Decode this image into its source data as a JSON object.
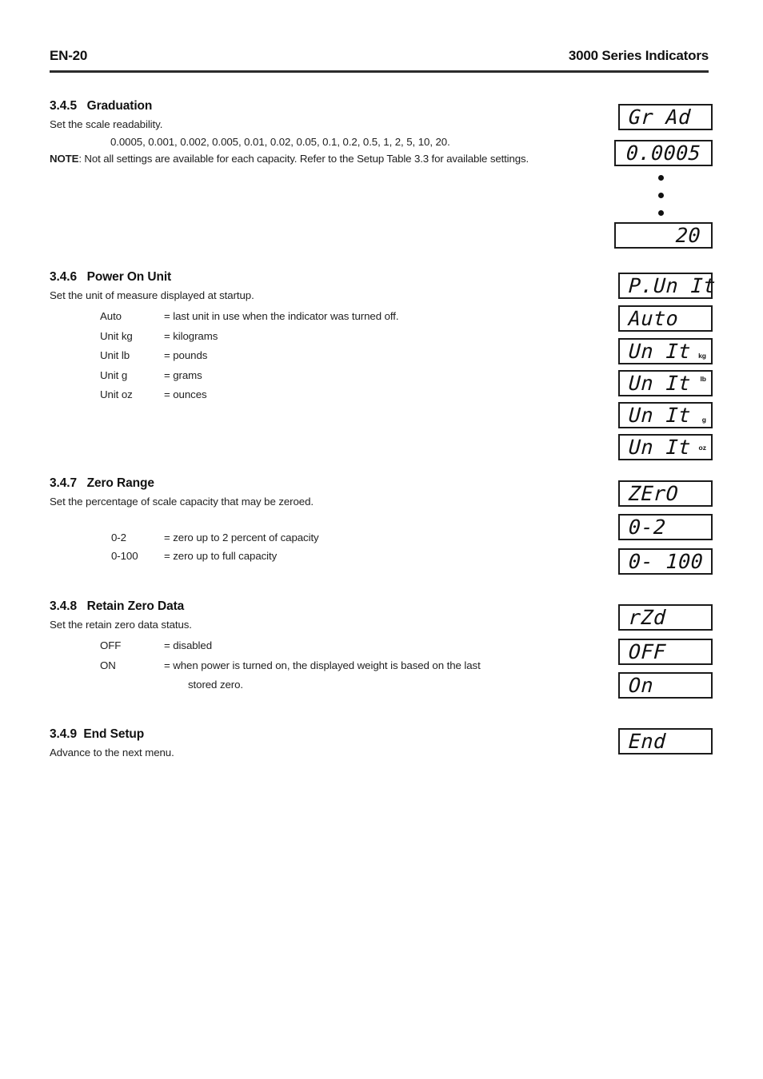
{
  "header": {
    "page_label": "EN-20",
    "doc_title": "3000 Series Indicators"
  },
  "sections": {
    "graduation": {
      "number": "3.4.5",
      "title": "Graduation",
      "description": "Set the scale readability.",
      "values": "0.0005, 0.001, 0.002, 0.005, 0.01, 0.02, 0.05, 0.1, 0.2, 0.5, 1, 2, 5, 10, 20.",
      "note_label": "NOTE",
      "note_text": ": Not all settings are available for each capacity.  Refer to the Setup Table 3.3 for available settings."
    },
    "power_on_unit": {
      "number": "3.4.6",
      "title": "Power On Unit",
      "description": "Set the unit of measure displayed at startup.",
      "rows": [
        {
          "term": "Auto",
          "def": "= last unit in use when the indicator was turned off."
        },
        {
          "term": "Unit kg",
          "def": "= kilograms"
        },
        {
          "term": "Unit lb",
          "def": "= pounds"
        },
        {
          "term": "Unit g",
          "def": "= grams"
        },
        {
          "term": "Unit oz",
          "def": "= ounces"
        }
      ]
    },
    "zero_range": {
      "number": "3.4.7",
      "title": "Zero Range",
      "description": "Set the percentage of scale capacity that may be zeroed.",
      "rows": [
        {
          "term": "0-2",
          "def": "= zero up to 2 percent of capacity"
        },
        {
          "term": "0-100",
          "def": "= zero up to full capacity"
        }
      ]
    },
    "retain_zero_data": {
      "number": "3.4.8",
      "title": "Retain Zero Data",
      "description": "Set the retain zero data status.",
      "rows": [
        {
          "term": "OFF",
          "def": "= disabled"
        },
        {
          "term": "ON",
          "def": "= when power is turned on, the displayed weight is based on the last"
        }
      ],
      "continuation": "stored zero."
    },
    "end_setup": {
      "number": "3.4.9",
      "title": "End Setup",
      "description": "Advance to the next menu."
    }
  },
  "lcd_displays": {
    "grad_menu": "Gr Ad",
    "grad_min": "0.0005",
    "grad_max": "20",
    "punit_menu": "P.Un It",
    "punit_auto": "Auto",
    "unit_kg": "Un It",
    "unit_kg_annunciator": "kg",
    "unit_lb": "Un It",
    "unit_lb_annunciator": "lb",
    "unit_g": "Un It",
    "unit_g_annunciator": "g",
    "unit_oz": "Un It",
    "unit_oz_annunciator": "oz",
    "zero_menu": "ZErO",
    "zero_0_2": "0-2",
    "zero_0_100": "0- 100",
    "rzd_menu": "rZd",
    "rzd_off": "OFF",
    "rzd_on": "On",
    "end_menu": "End"
  }
}
